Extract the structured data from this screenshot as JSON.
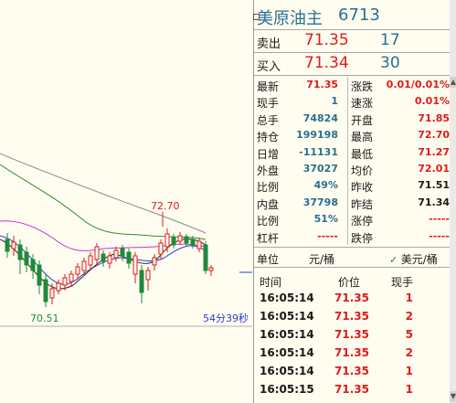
{
  "chart": {
    "high_label": "72.70",
    "low_label": "70.51",
    "countdown": "54分39秒"
  },
  "quote": {
    "name": "美原油主",
    "code": "6713",
    "ask_label": "卖出",
    "ask_price": "71.35",
    "ask_volume": "17",
    "bid_label": "买入",
    "bid_price": "71.34",
    "bid_volume": "30",
    "rows": [
      {
        "l1": "最新",
        "v1": "71.35",
        "c1": "red",
        "l2": "涨跌",
        "v2": "0.01/0.01%",
        "c2": "red"
      },
      {
        "l1": "现手",
        "v1": "1",
        "c1": "teal",
        "l2": "速涨",
        "v2": "0.01%",
        "c2": "red"
      },
      {
        "l1": "总手",
        "v1": "74824",
        "c1": "teal",
        "l2": "开盘",
        "v2": "71.85",
        "c2": "red"
      },
      {
        "l1": "持仓",
        "v1": "199198",
        "c1": "teal",
        "l2": "最高",
        "v2": "72.70",
        "c2": "red"
      },
      {
        "l1": "日增",
        "v1": "-11131",
        "c1": "teal",
        "l2": "最低",
        "v2": "71.27",
        "c2": "red"
      },
      {
        "l1": "外盘",
        "v1": "37027",
        "c1": "teal",
        "l2": "均价",
        "v2": "72.01",
        "c2": "red"
      },
      {
        "l1": "比例",
        "v1": "49%",
        "c1": "teal",
        "l2": "昨收",
        "v2": "71.51",
        "c2": "black"
      },
      {
        "l1": "内盘",
        "v1": "37798",
        "c1": "teal",
        "l2": "昨结",
        "v2": "71.34",
        "c2": "black"
      },
      {
        "l1": "比例",
        "v1": "51%",
        "c1": "teal",
        "l2": "涨停",
        "v2": "-----",
        "c2": "red"
      },
      {
        "l1": "杠杆",
        "v1": "-----",
        "c1": "red",
        "l2": "跌停",
        "v2": "-----",
        "c2": "red"
      }
    ],
    "unit_label": "单位",
    "unit_value": "元/桶",
    "currency_option": "美元/桶"
  },
  "ticks": {
    "headers": {
      "time": "时间",
      "price": "价位",
      "qty": "现手"
    },
    "rows": [
      {
        "time": "16:05:14",
        "price": "71.35",
        "qty": "1"
      },
      {
        "time": "16:05:14",
        "price": "71.35",
        "qty": "2"
      },
      {
        "time": "16:05:14",
        "price": "71.35",
        "qty": "5"
      },
      {
        "time": "16:05:14",
        "price": "71.35",
        "qty": "2"
      },
      {
        "time": "16:05:14",
        "price": "71.35",
        "qty": "1"
      },
      {
        "time": "16:05:15",
        "price": "71.35",
        "qty": "1"
      }
    ]
  },
  "colors": {
    "up": "#e01a1a",
    "down": "#1f8a3a",
    "ma_black": "#2b2b2b",
    "ma_magenta": "#cc33cc",
    "ma_blue": "#2a3fcf",
    "ma_green": "#2d8f2d",
    "ma_gray": "#8a8a8a"
  }
}
